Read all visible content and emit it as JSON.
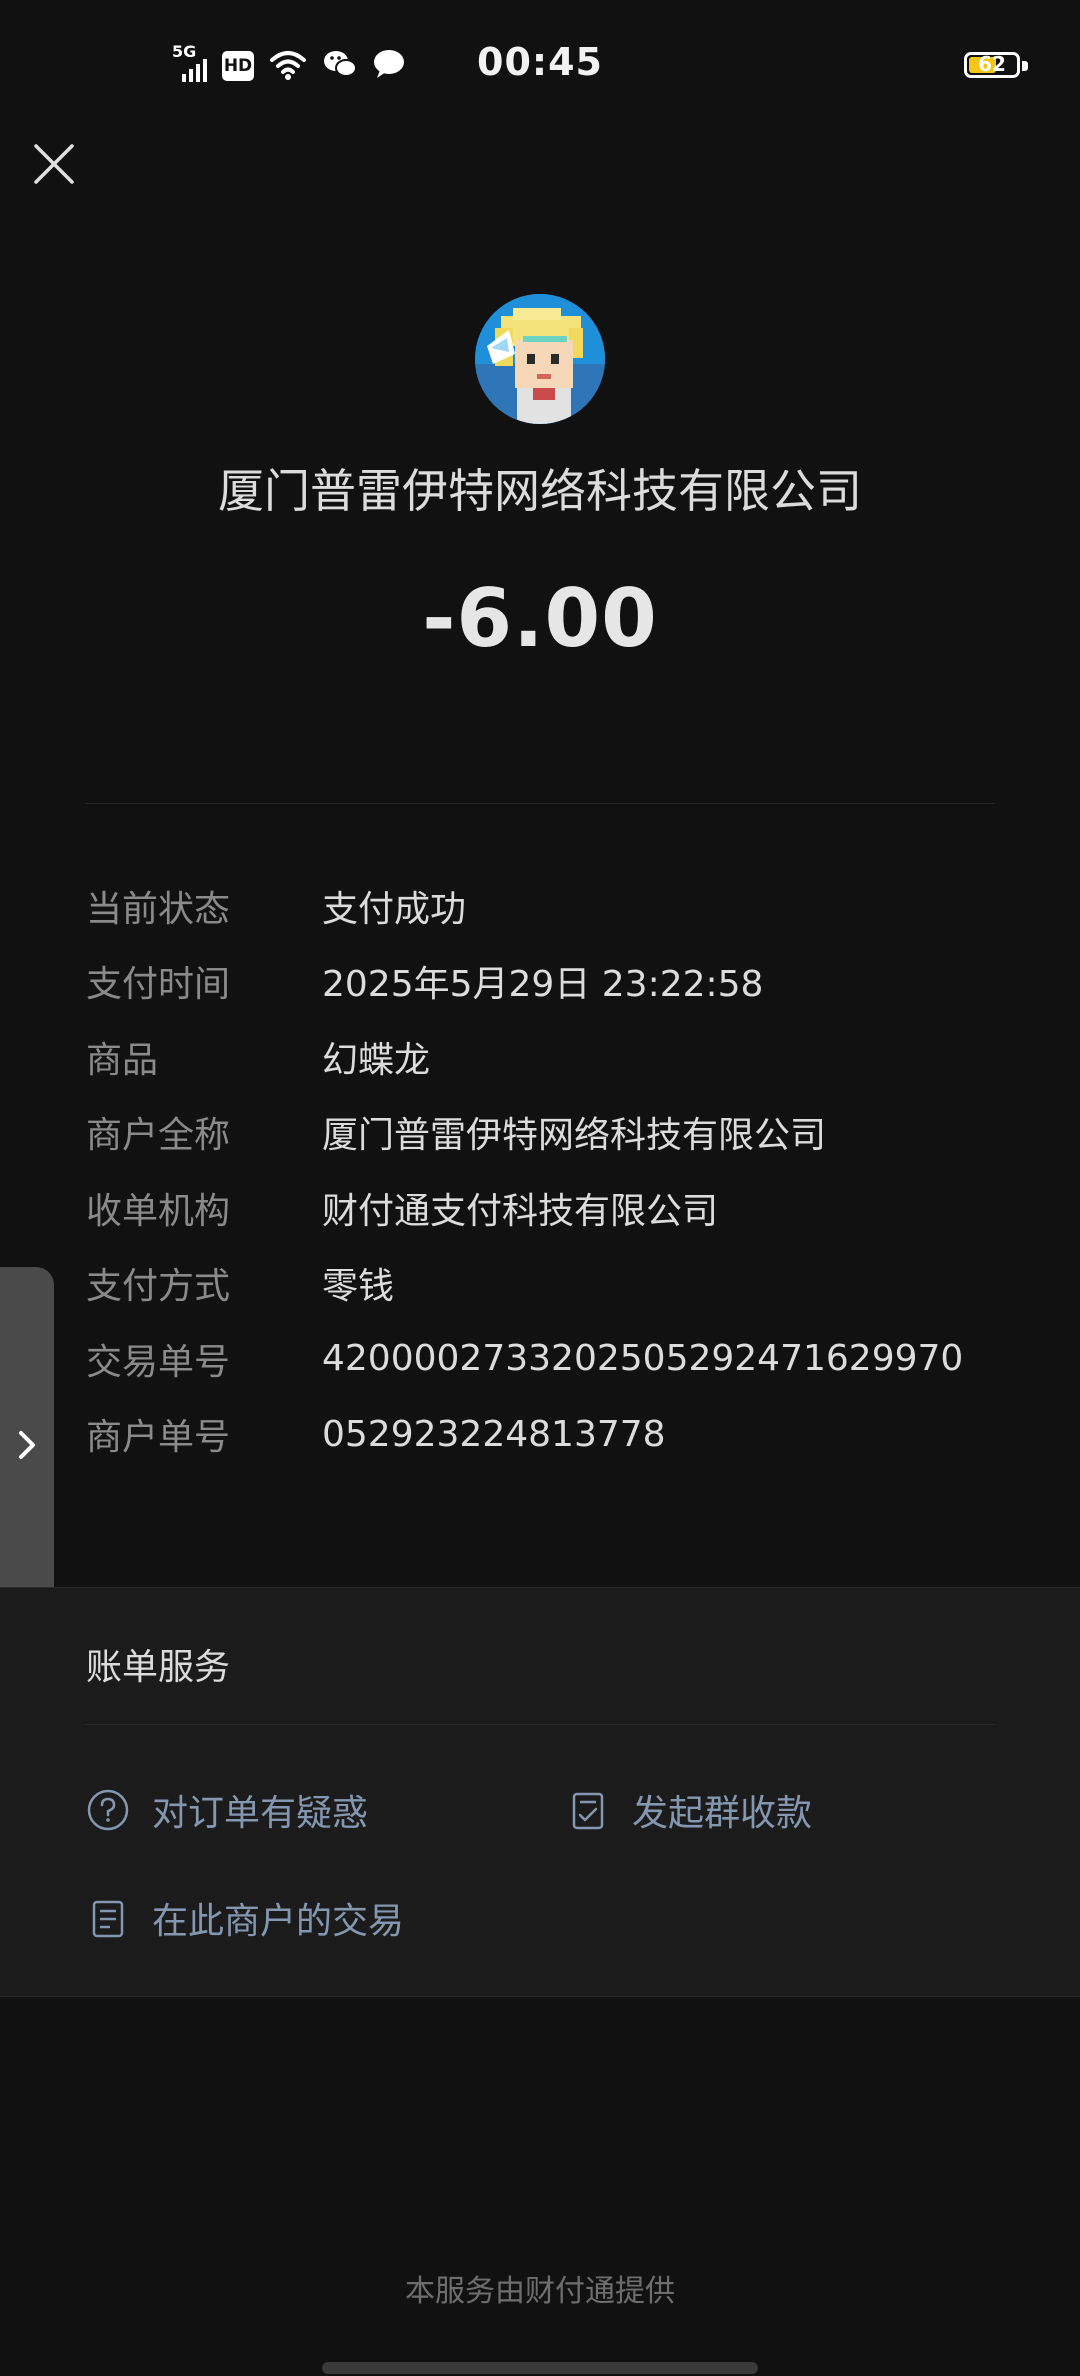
{
  "status_bar": {
    "time": "00:45",
    "network_label": "5G",
    "hd_label": "HD",
    "battery_level": 62,
    "battery_text": "62"
  },
  "header": {
    "merchant_name": "厦门普雷伊特网络科技有限公司",
    "amount": "-6.00"
  },
  "details": [
    {
      "label": "当前状态",
      "value": "支付成功"
    },
    {
      "label": "支付时间",
      "value": "2025年5月29日 23:22:58"
    },
    {
      "label": "商品",
      "value": "幻蝶龙"
    },
    {
      "label": "商户全称",
      "value": "厦门普雷伊特网络科技有限公司"
    },
    {
      "label": "收单机构",
      "value": "财付通支付科技有限公司"
    },
    {
      "label": "支付方式",
      "value": "零钱"
    },
    {
      "label": "交易单号",
      "value": "4200002733202505292471629970"
    },
    {
      "label": "商户单号",
      "value": "052923224813778"
    }
  ],
  "services": {
    "title": "账单服务",
    "links": [
      {
        "label": "对订单有疑惑",
        "icon": "question-circle-icon"
      },
      {
        "label": "发起群收款",
        "icon": "checklist-doc-icon"
      },
      {
        "label": "在此商户的交易",
        "icon": "document-icon"
      }
    ]
  },
  "footer": "本服务由财付通提供",
  "colors": {
    "background": "#111111",
    "card": "#1b1b1b",
    "link": "#8497b0",
    "battery": "#f5c518"
  }
}
